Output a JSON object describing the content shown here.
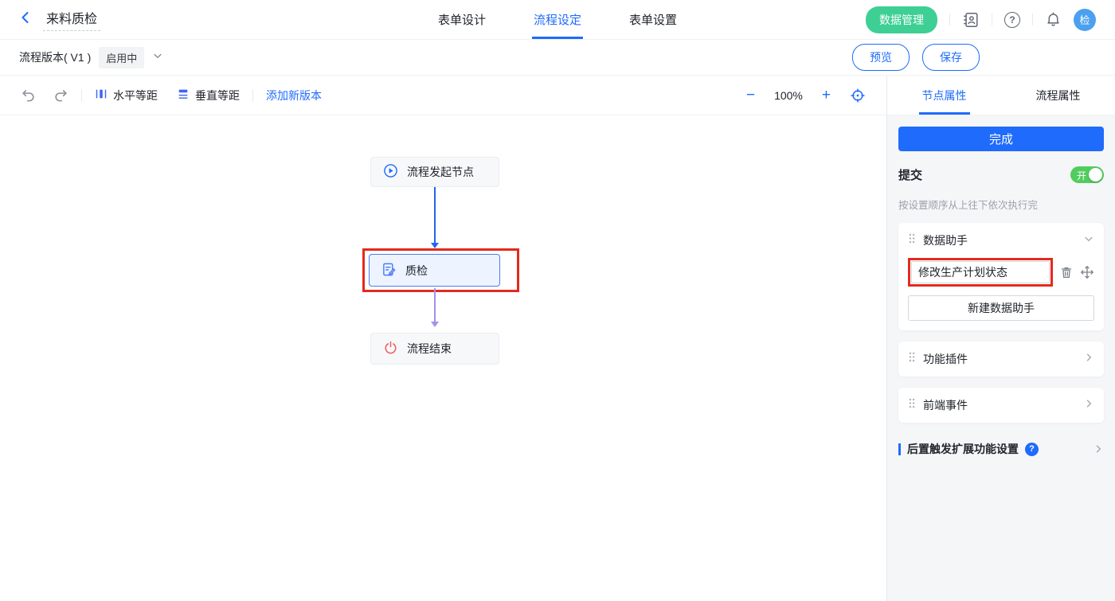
{
  "header": {
    "title": "来料质检",
    "tabs": [
      {
        "label": "表单设计"
      },
      {
        "label": "流程设定"
      },
      {
        "label": "表单设置"
      }
    ],
    "data_manage_label": "数据管理",
    "avatar_text": "检"
  },
  "icons": {
    "help_glyph": "?"
  },
  "version_bar": {
    "version_label": "流程版本( V1 )",
    "status_badge": "启用中",
    "preview_label": "预览",
    "save_label": "保存"
  },
  "toolbar": {
    "horizontal_spacing": "水平等距",
    "vertical_spacing": "垂直等距",
    "add_version": "添加新版本",
    "zoom_out": "−",
    "zoom_level": "100%",
    "zoom_in": "+"
  },
  "canvas": {
    "start_node_label": "流程发起节点",
    "qc_node_label": "质检",
    "end_node_label": "流程结束"
  },
  "panel": {
    "tabs": [
      {
        "label": "节点属性"
      },
      {
        "label": "流程属性"
      }
    ],
    "done_label": "完成",
    "submit_label": "提交",
    "toggle_on_label": "开",
    "order_hint": "按设置顺序从上往下依次执行完",
    "sections": {
      "data_assistant": {
        "title": "数据助手",
        "item": "修改生产计划状态",
        "new_button": "新建数据助手"
      },
      "plugin": {
        "title": "功能插件"
      },
      "frontend_event": {
        "title": "前端事件"
      }
    },
    "post_trigger": {
      "label": "后置触发扩展功能设置"
    }
  },
  "colors": {
    "accent_blue": "#1f6bfb",
    "green_button": "#3ecf94",
    "toggle_green": "#52cc5e",
    "annotation_red": "#e32a1d",
    "connector_blue": "#2064f0",
    "connector_purple": "#a491f0",
    "avatar_blue": "#4ba0f0"
  }
}
